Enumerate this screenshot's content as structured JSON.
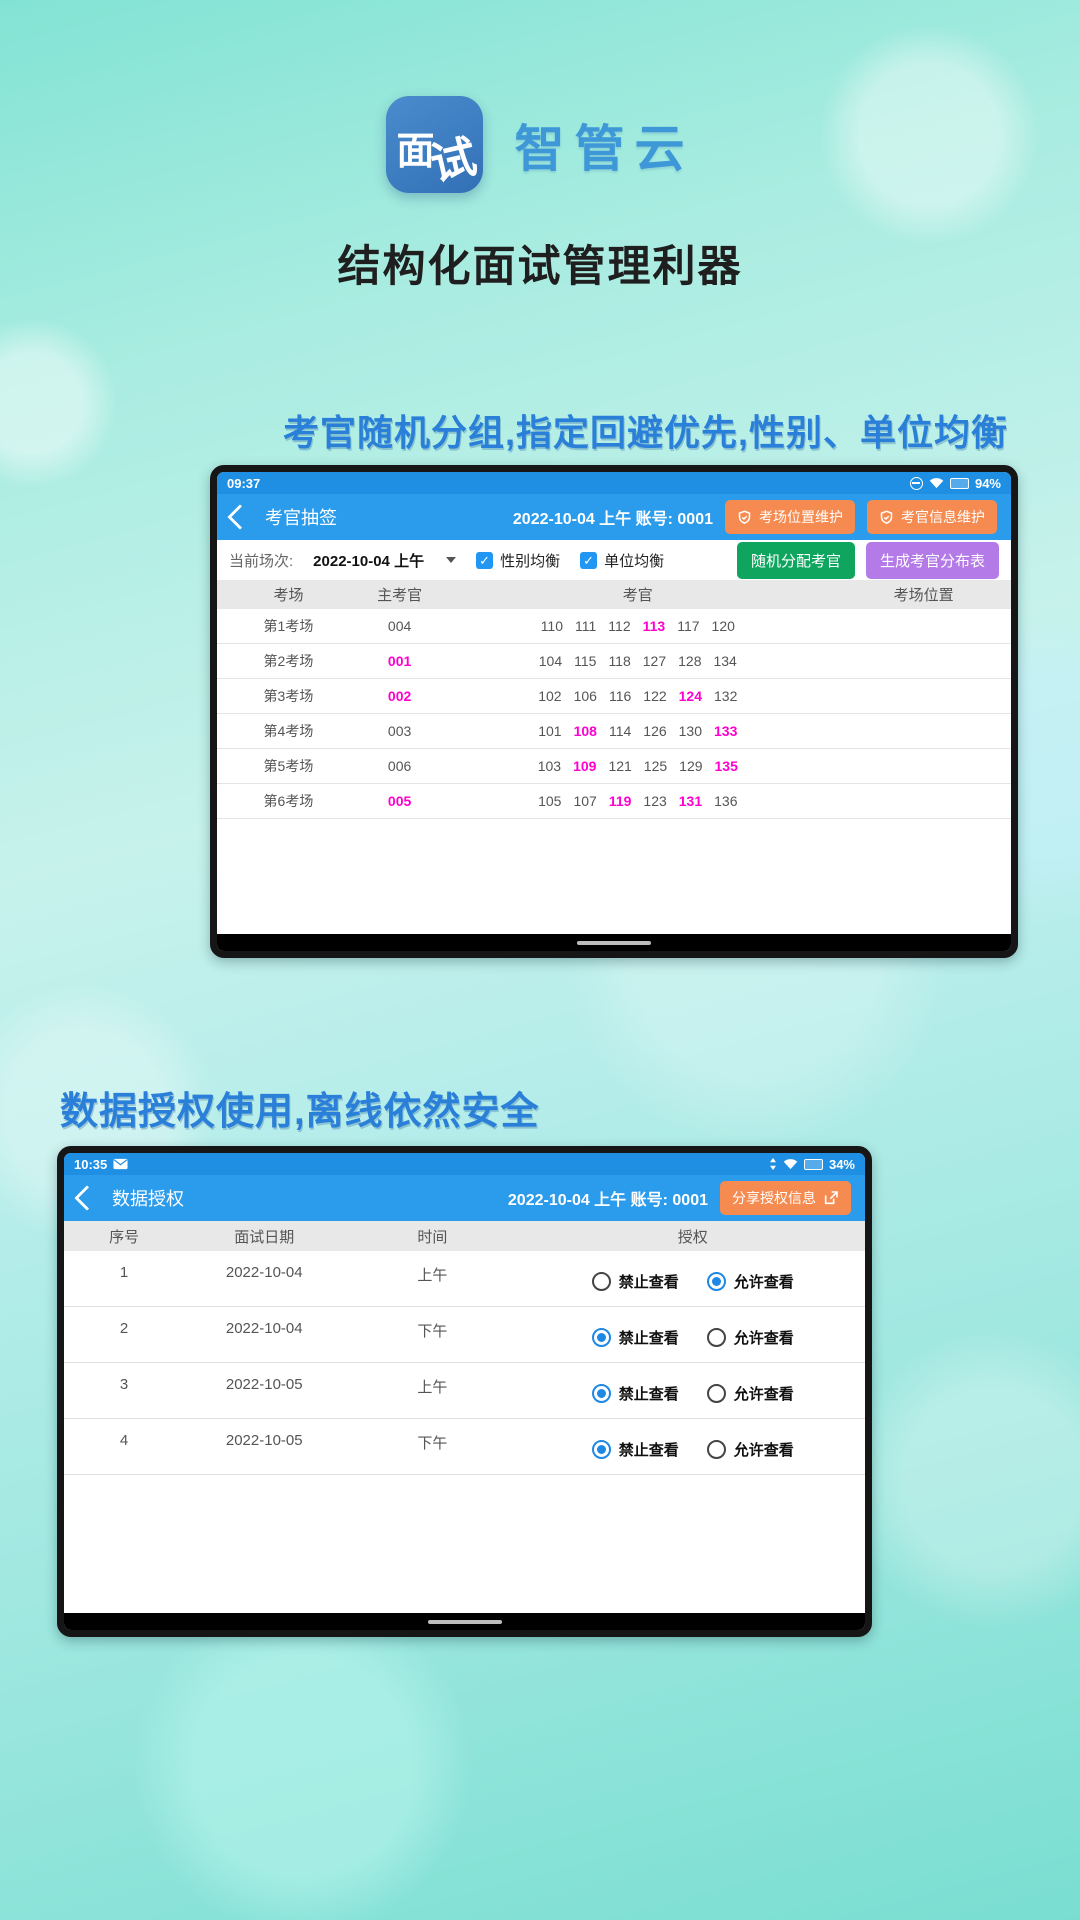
{
  "brand": {
    "logo_text_1": "面",
    "logo_text_2": "试",
    "name": "智管云",
    "title": "结构化面试管理利器"
  },
  "slogans": {
    "first": "考官随机分组,指定回避优先,性别、单位均衡",
    "second": "数据授权使用,离线依然安全"
  },
  "colors": {
    "brand_blue": "#3E98D8",
    "slogan_blue": "#2A7FD8",
    "nav_blue": "#2B9BEC",
    "status_blue": "#1E8FE3",
    "orange": "#F58B50",
    "green": "#0FA55E",
    "purple": "#B47AE8",
    "highlight_pink": "#FF00CE",
    "checkbox_blue": "#2196F3",
    "radio_blue": "#1E88E5"
  },
  "tablet1": {
    "status": {
      "time": "09:37",
      "battery": "94%"
    },
    "nav": {
      "title": "考官抽签",
      "session": "2022-10-04 上午 账号: 0001",
      "maintain_location": "考场位置维护",
      "maintain_examiner": "考官信息维护"
    },
    "toolbar": {
      "session_label": "当前场次:",
      "session_value": "2022-10-04 上午",
      "gender_balance": "性别均衡",
      "unit_balance": "单位均衡",
      "assign_button": "随机分配考官",
      "generate_button": "生成考官分布表"
    },
    "table": {
      "headers": {
        "room": "考场",
        "chief": "主考官",
        "examiners": "考官",
        "position": "考场位置"
      },
      "rows": [
        {
          "room": "第1考场",
          "chief": "004",
          "chief_hl": false,
          "examiners": [
            {
              "v": "110",
              "hl": false
            },
            {
              "v": "111",
              "hl": false
            },
            {
              "v": "112",
              "hl": false
            },
            {
              "v": "113",
              "hl": true
            },
            {
              "v": "117",
              "hl": false
            },
            {
              "v": "120",
              "hl": false
            }
          ]
        },
        {
          "room": "第2考场",
          "chief": "001",
          "chief_hl": true,
          "examiners": [
            {
              "v": "104",
              "hl": false
            },
            {
              "v": "115",
              "hl": false
            },
            {
              "v": "118",
              "hl": false
            },
            {
              "v": "127",
              "hl": false
            },
            {
              "v": "128",
              "hl": false
            },
            {
              "v": "134",
              "hl": false
            }
          ]
        },
        {
          "room": "第3考场",
          "chief": "002",
          "chief_hl": true,
          "examiners": [
            {
              "v": "102",
              "hl": false
            },
            {
              "v": "106",
              "hl": false
            },
            {
              "v": "116",
              "hl": false
            },
            {
              "v": "122",
              "hl": false
            },
            {
              "v": "124",
              "hl": true
            },
            {
              "v": "132",
              "hl": false
            }
          ]
        },
        {
          "room": "第4考场",
          "chief": "003",
          "chief_hl": false,
          "examiners": [
            {
              "v": "101",
              "hl": false
            },
            {
              "v": "108",
              "hl": true
            },
            {
              "v": "114",
              "hl": false
            },
            {
              "v": "126",
              "hl": false
            },
            {
              "v": "130",
              "hl": false
            },
            {
              "v": "133",
              "hl": true
            }
          ]
        },
        {
          "room": "第5考场",
          "chief": "006",
          "chief_hl": false,
          "examiners": [
            {
              "v": "103",
              "hl": false
            },
            {
              "v": "109",
              "hl": true
            },
            {
              "v": "121",
              "hl": false
            },
            {
              "v": "125",
              "hl": false
            },
            {
              "v": "129",
              "hl": false
            },
            {
              "v": "135",
              "hl": true
            }
          ]
        },
        {
          "room": "第6考场",
          "chief": "005",
          "chief_hl": true,
          "examiners": [
            {
              "v": "105",
              "hl": false
            },
            {
              "v": "107",
              "hl": false
            },
            {
              "v": "119",
              "hl": true
            },
            {
              "v": "123",
              "hl": false
            },
            {
              "v": "131",
              "hl": true
            },
            {
              "v": "136",
              "hl": false
            }
          ]
        }
      ]
    }
  },
  "tablet2": {
    "status": {
      "time": "10:35",
      "battery": "34%"
    },
    "nav": {
      "title": "数据授权",
      "session": "2022-10-04 上午 账号: 0001",
      "share_button": "分享授权信息"
    },
    "table": {
      "headers": {
        "no": "序号",
        "date": "面试日期",
        "time": "时间",
        "auth": "授权"
      },
      "labels": {
        "deny": "禁止查看",
        "allow": "允许查看"
      },
      "rows": [
        {
          "no": "1",
          "date": "2022-10-04",
          "time": "上午",
          "deny_on": false,
          "allow_on": true
        },
        {
          "no": "2",
          "date": "2022-10-04",
          "time": "下午",
          "deny_on": true,
          "allow_on": false
        },
        {
          "no": "3",
          "date": "2022-10-05",
          "time": "上午",
          "deny_on": true,
          "allow_on": false
        },
        {
          "no": "4",
          "date": "2022-10-05",
          "time": "下午",
          "deny_on": true,
          "allow_on": false
        }
      ]
    }
  }
}
